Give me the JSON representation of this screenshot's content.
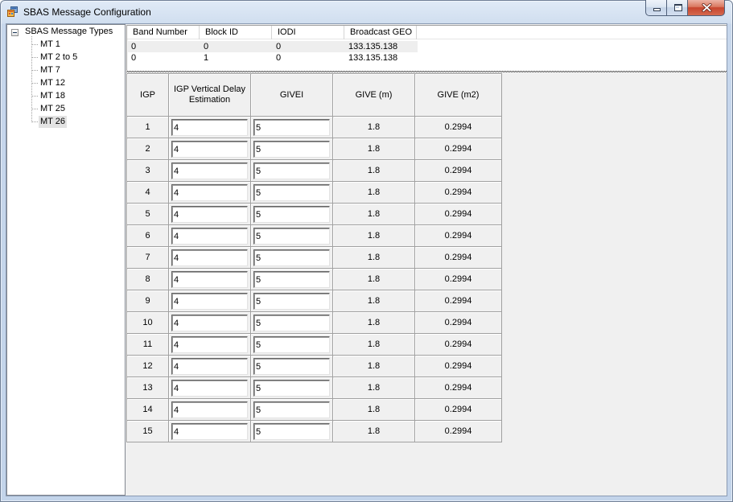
{
  "window": {
    "title": "SBAS Message Configuration"
  },
  "icons": {
    "app": "app-icon",
    "minimize": "minimize-icon",
    "maximize": "maximize-icon",
    "close": "close-icon",
    "tree_expander": "collapse-icon"
  },
  "theme": {
    "panel_bg": "#f0f0f0",
    "grid_line": "#a0a0a0",
    "tree_selection": "#e3e3e3",
    "close_button": "#c7452e"
  },
  "tree": {
    "root": {
      "label": "SBAS Message Types",
      "expanded": true
    },
    "items": [
      {
        "label": "MT 1",
        "selected": false
      },
      {
        "label": "MT 2 to 5",
        "selected": false
      },
      {
        "label": "MT 7",
        "selected": false
      },
      {
        "label": "MT 12",
        "selected": false
      },
      {
        "label": "MT 18",
        "selected": false
      },
      {
        "label": "MT 25",
        "selected": false
      },
      {
        "label": "MT 26",
        "selected": true
      }
    ]
  },
  "block_list": {
    "columns": [
      "Band Number",
      "Block ID",
      "IODI",
      "Broadcast GEO"
    ],
    "rows": [
      [
        "0",
        "0",
        "0",
        "133.135.138"
      ],
      [
        "0",
        "1",
        "0",
        "133.135.138"
      ]
    ],
    "highlighted_row": 0
  },
  "igp_grid": {
    "headers": [
      "IGP",
      "IGP Vertical Delay Estimation",
      "GIVEI",
      "GIVE (m)",
      "GIVE (m2)"
    ],
    "rows": [
      {
        "igp": "1",
        "vertical_delay": "4",
        "givei": "5",
        "give_m": "1.8",
        "give_m2": "0.2994"
      },
      {
        "igp": "2",
        "vertical_delay": "4",
        "givei": "5",
        "give_m": "1.8",
        "give_m2": "0.2994"
      },
      {
        "igp": "3",
        "vertical_delay": "4",
        "givei": "5",
        "give_m": "1.8",
        "give_m2": "0.2994"
      },
      {
        "igp": "4",
        "vertical_delay": "4",
        "givei": "5",
        "give_m": "1.8",
        "give_m2": "0.2994"
      },
      {
        "igp": "5",
        "vertical_delay": "4",
        "givei": "5",
        "give_m": "1.8",
        "give_m2": "0.2994"
      },
      {
        "igp": "6",
        "vertical_delay": "4",
        "givei": "5",
        "give_m": "1.8",
        "give_m2": "0.2994"
      },
      {
        "igp": "7",
        "vertical_delay": "4",
        "givei": "5",
        "give_m": "1.8",
        "give_m2": "0.2994"
      },
      {
        "igp": "8",
        "vertical_delay": "4",
        "givei": "5",
        "give_m": "1.8",
        "give_m2": "0.2994"
      },
      {
        "igp": "9",
        "vertical_delay": "4",
        "givei": "5",
        "give_m": "1.8",
        "give_m2": "0.2994"
      },
      {
        "igp": "10",
        "vertical_delay": "4",
        "givei": "5",
        "give_m": "1.8",
        "give_m2": "0.2994"
      },
      {
        "igp": "11",
        "vertical_delay": "4",
        "givei": "5",
        "give_m": "1.8",
        "give_m2": "0.2994"
      },
      {
        "igp": "12",
        "vertical_delay": "4",
        "givei": "5",
        "give_m": "1.8",
        "give_m2": "0.2994"
      },
      {
        "igp": "13",
        "vertical_delay": "4",
        "givei": "5",
        "give_m": "1.8",
        "give_m2": "0.2994"
      },
      {
        "igp": "14",
        "vertical_delay": "4",
        "givei": "5",
        "give_m": "1.8",
        "give_m2": "0.2994"
      },
      {
        "igp": "15",
        "vertical_delay": "4",
        "givei": "5",
        "give_m": "1.8",
        "give_m2": "0.2994"
      }
    ]
  }
}
